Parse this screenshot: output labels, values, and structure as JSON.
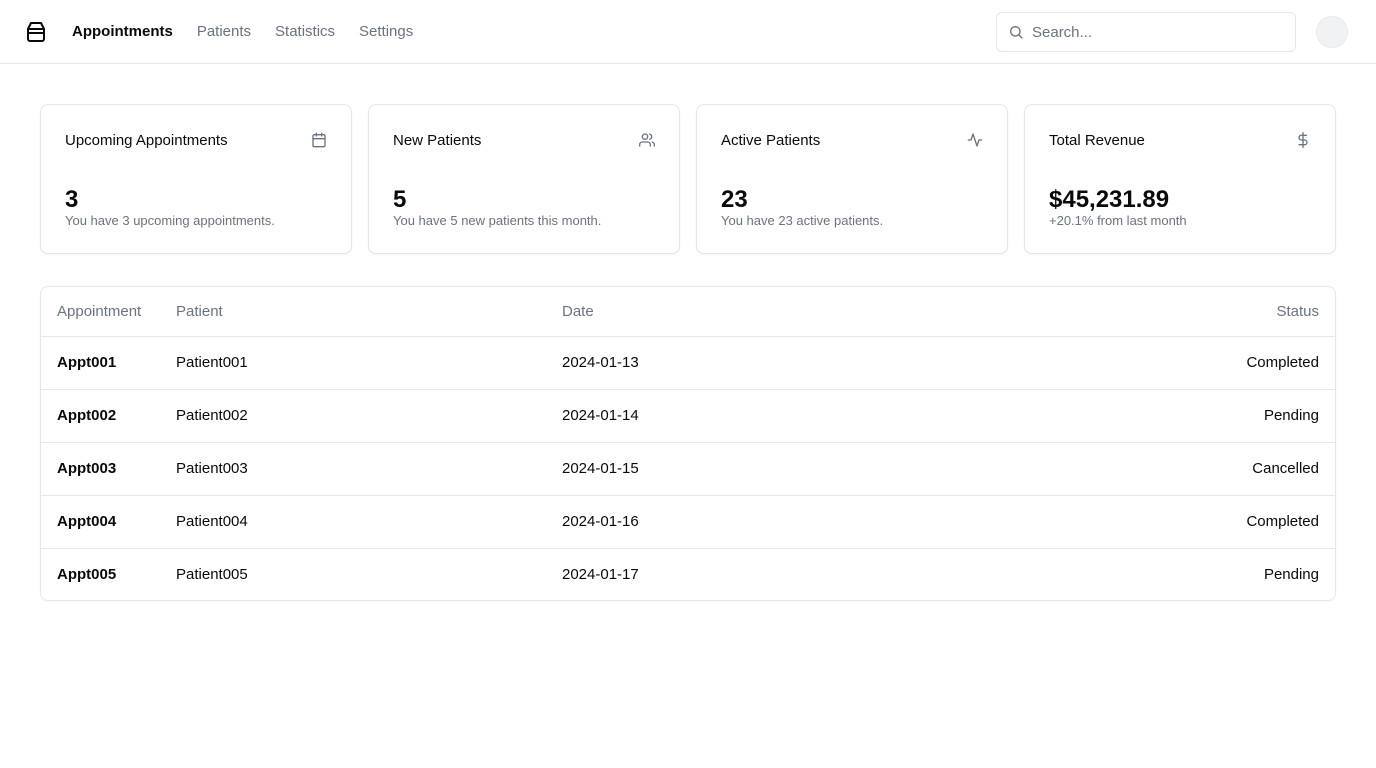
{
  "header": {
    "nav": [
      {
        "label": "Appointments",
        "active": true
      },
      {
        "label": "Patients",
        "active": false
      },
      {
        "label": "Statistics",
        "active": false
      },
      {
        "label": "Settings",
        "active": false
      }
    ],
    "search": {
      "placeholder": "Search...",
      "value": "",
      "icon": "search-icon"
    },
    "logo_icon": "package-icon",
    "avatar": "user-avatar"
  },
  "cards": [
    {
      "title": "Upcoming Appointments",
      "value": "3",
      "subtitle": "You have 3 upcoming appointments.",
      "icon": "calendar-icon"
    },
    {
      "title": "New Patients",
      "value": "5",
      "subtitle": "You have 5 new patients this month.",
      "icon": "users-icon"
    },
    {
      "title": "Active Patients",
      "value": "23",
      "subtitle": "You have 23 active patients.",
      "icon": "activity-icon"
    },
    {
      "title": "Total Revenue",
      "value": "$45,231.89",
      "subtitle": "+20.1% from last month",
      "icon": "dollar-icon"
    }
  ],
  "table": {
    "columns": [
      "Appointment",
      "Patient",
      "Date",
      "Status"
    ],
    "rows": [
      {
        "appointment": "Appt001",
        "patient": "Patient001",
        "date": "2024-01-13",
        "status": "Completed"
      },
      {
        "appointment": "Appt002",
        "patient": "Patient002",
        "date": "2024-01-14",
        "status": "Pending"
      },
      {
        "appointment": "Appt003",
        "patient": "Patient003",
        "date": "2024-01-15",
        "status": "Cancelled"
      },
      {
        "appointment": "Appt004",
        "patient": "Patient004",
        "date": "2024-01-16",
        "status": "Completed"
      },
      {
        "appointment": "Appt005",
        "patient": "Patient005",
        "date": "2024-01-17",
        "status": "Pending"
      }
    ]
  }
}
